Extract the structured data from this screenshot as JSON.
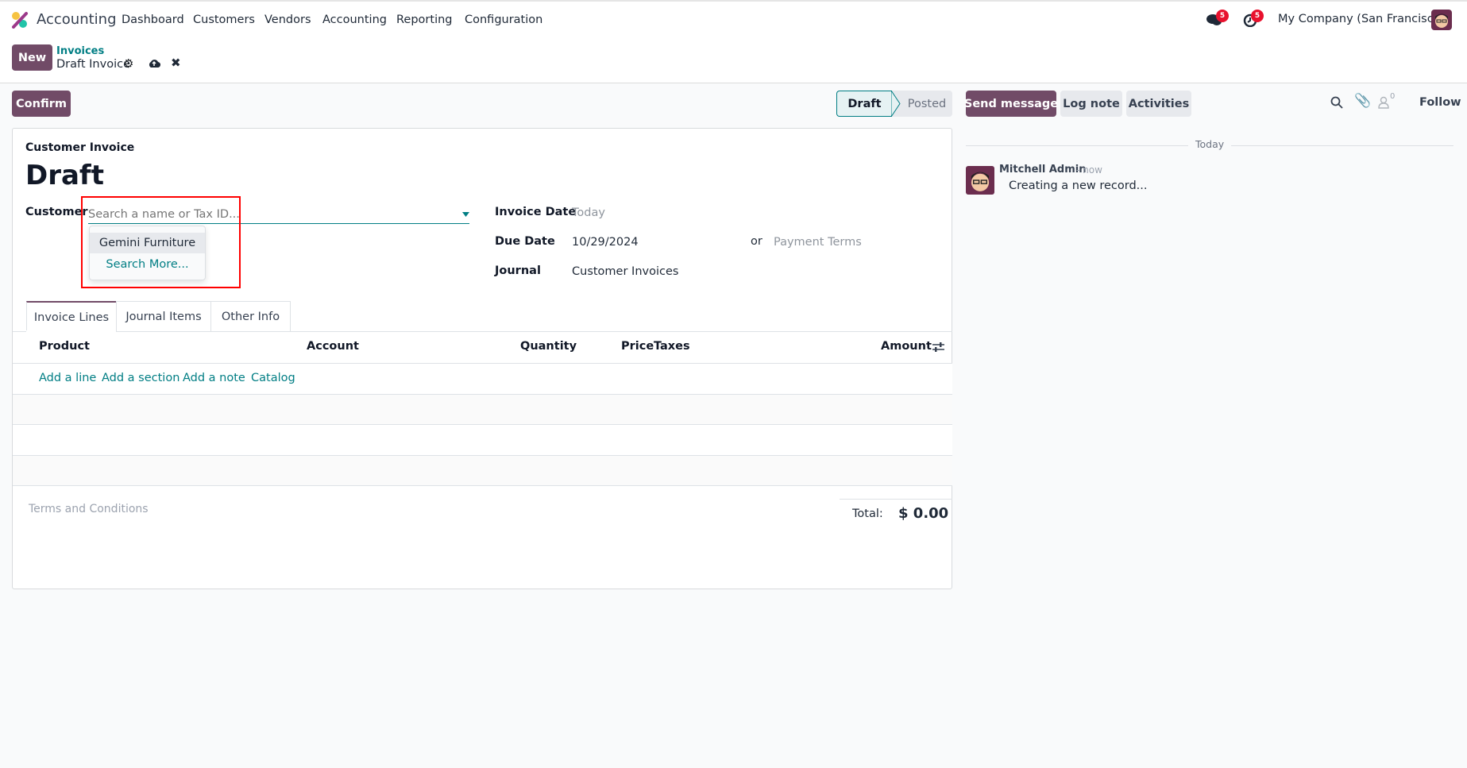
{
  "navbar": {
    "app_name": "Accounting",
    "menu": [
      "Dashboard",
      "Customers",
      "Vendors",
      "Accounting",
      "Reporting",
      "Configuration"
    ],
    "messages_count": "5",
    "activities_count": "5",
    "company": "My Company (San Francisco)"
  },
  "control_panel": {
    "new_label": "New",
    "breadcrumb_parent": "Invoices",
    "breadcrumb_current": "Draft Invoice"
  },
  "actions": {
    "confirm_label": "Confirm"
  },
  "statusbar": {
    "stages": [
      "Draft",
      "Posted"
    ],
    "active": "Draft"
  },
  "chatter": {
    "send_message": "Send message",
    "log_note": "Log note",
    "activities": "Activities",
    "followers_count": "0",
    "follow": "Follow",
    "date_separator": "Today",
    "messages": [
      {
        "author": "Mitchell Admin",
        "time": "- now",
        "body": "Creating a new record..."
      }
    ]
  },
  "form": {
    "type_label": "Customer Invoice",
    "title": "Draft",
    "customer": {
      "label": "Customer",
      "placeholder": "Search a name or Tax ID...",
      "dropdown": [
        "Gemini Furniture",
        "Search More..."
      ]
    },
    "invoice_date": {
      "label": "Invoice Date",
      "placeholder": "Today"
    },
    "due_date": {
      "label": "Due Date",
      "value": "10/29/2024",
      "or": "or",
      "payment_terms_placeholder": "Payment Terms"
    },
    "journal": {
      "label": "Journal",
      "value": "Customer Invoices"
    },
    "tabs": [
      "Invoice Lines",
      "Journal Items",
      "Other Info"
    ],
    "columns": [
      "Product",
      "Account",
      "Quantity",
      "Price",
      "Taxes",
      "Amount"
    ],
    "add_links": [
      "Add a line",
      "Add a section",
      "Add a note",
      "Catalog"
    ],
    "terms_placeholder": "Terms and Conditions",
    "total_label": "Total:",
    "total_value": "$ 0.00"
  },
  "colors": {
    "brand": "#714b67",
    "link": "#017e84",
    "highlight": "#ff0000",
    "badge": "#e8112d"
  }
}
